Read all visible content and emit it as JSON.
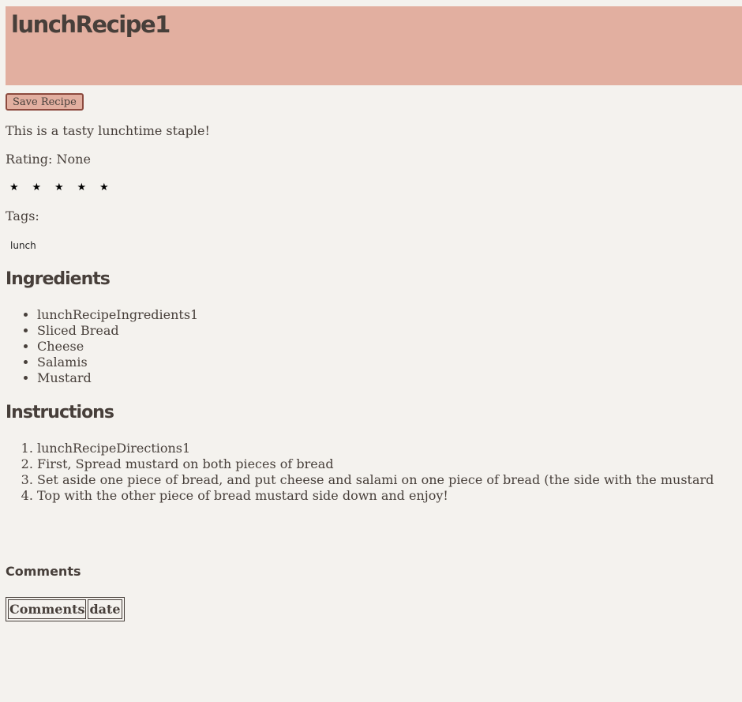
{
  "page": {
    "title": "lunchRecipe1",
    "save_button_label": "Save Recipe",
    "description": "This is a tasty lunchtime staple!",
    "rating_text": "Rating: None",
    "rating_value": null,
    "stars": [
      "★",
      "★",
      "★",
      "★",
      "★"
    ],
    "tags_label": "Tags:",
    "tags": [
      "lunch"
    ]
  },
  "ingredients": {
    "heading": "Ingredients",
    "items": [
      "lunchRecipeIngredients1",
      "Sliced Bread",
      "Cheese",
      "Salamis",
      "Mustard"
    ]
  },
  "instructions": {
    "heading": "Instructions",
    "steps": [
      "lunchRecipeDirections1",
      "First, Spread mustard on both pieces of bread",
      "Set aside one piece of bread, and put cheese and salami on one piece of bread (the side with the mustard",
      "Top with the other piece of bread mustard side down and enjoy!"
    ]
  },
  "comments": {
    "label": "Comments",
    "columns": [
      "Comments",
      "date"
    ]
  },
  "colors": {
    "header_bg": "#e2afa0",
    "page_bg": "#f4f2ee",
    "text": "#473f3a",
    "button_border": "#8c4a3e"
  }
}
